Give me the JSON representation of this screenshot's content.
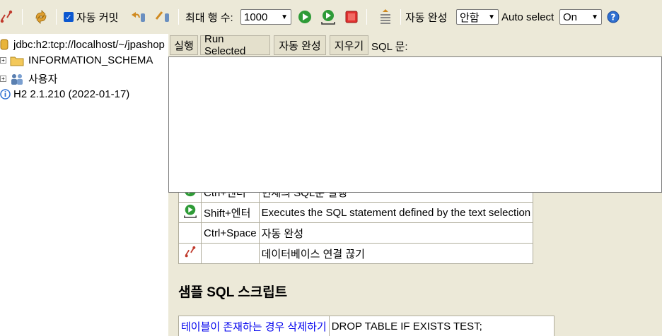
{
  "toolbar": {
    "auto_commit_label": "자동 커밋",
    "auto_commit_checked": true,
    "max_rows_label": "최대 행 수:",
    "max_rows_value": "1000",
    "auto_complete_label": "자동 완성",
    "auto_complete_value": "안함",
    "auto_select_label": "Auto select",
    "auto_select_value": "On",
    "icons": [
      "disconnect-icon",
      "refresh-icon",
      "rollback-icon",
      "commit-icon",
      "run-icon",
      "run-selected-icon",
      "stop-icon",
      "history-icon",
      "help-icon"
    ],
    "colors": {
      "toolbar_bg": "#ece9d8",
      "run_green": "#2e9b37",
      "stop_red": "#e0312f",
      "help_blue": "#2e6fd1"
    }
  },
  "tree": {
    "connection": "jdbc:h2:tcp://localhost/~/jpashop",
    "schema": "INFORMATION_SCHEMA",
    "users": "사용자",
    "version": "H2 2.1.210 (2022-01-17)"
  },
  "query": {
    "run_button": "실행",
    "run_selected_button": "Run Selected",
    "auto_complete_button": "자동 완성",
    "clear_button": "지우기",
    "sql_label": "SQL 문:"
  },
  "help_table": {
    "rows": [
      {
        "icon": "run-icon",
        "key": "Ctrl+엔터",
        "desc": "현재의 SQL문 실행"
      },
      {
        "icon": "run-selected-icon",
        "key": "Shift+엔터",
        "desc": "Executes the SQL statement defined by the text selection"
      },
      {
        "icon": "",
        "key": "Ctrl+Space",
        "desc": "자동 완성"
      },
      {
        "icon": "disconnect-icon",
        "key": "",
        "desc": "데이터베이스 연결 끊기"
      }
    ]
  },
  "sample": {
    "heading": "샘플 SQL 스크립트",
    "rows": [
      {
        "label": "테이블이 존재하는 경우 삭제하기",
        "sql": "DROP TABLE IF EXISTS TEST;"
      }
    ]
  }
}
